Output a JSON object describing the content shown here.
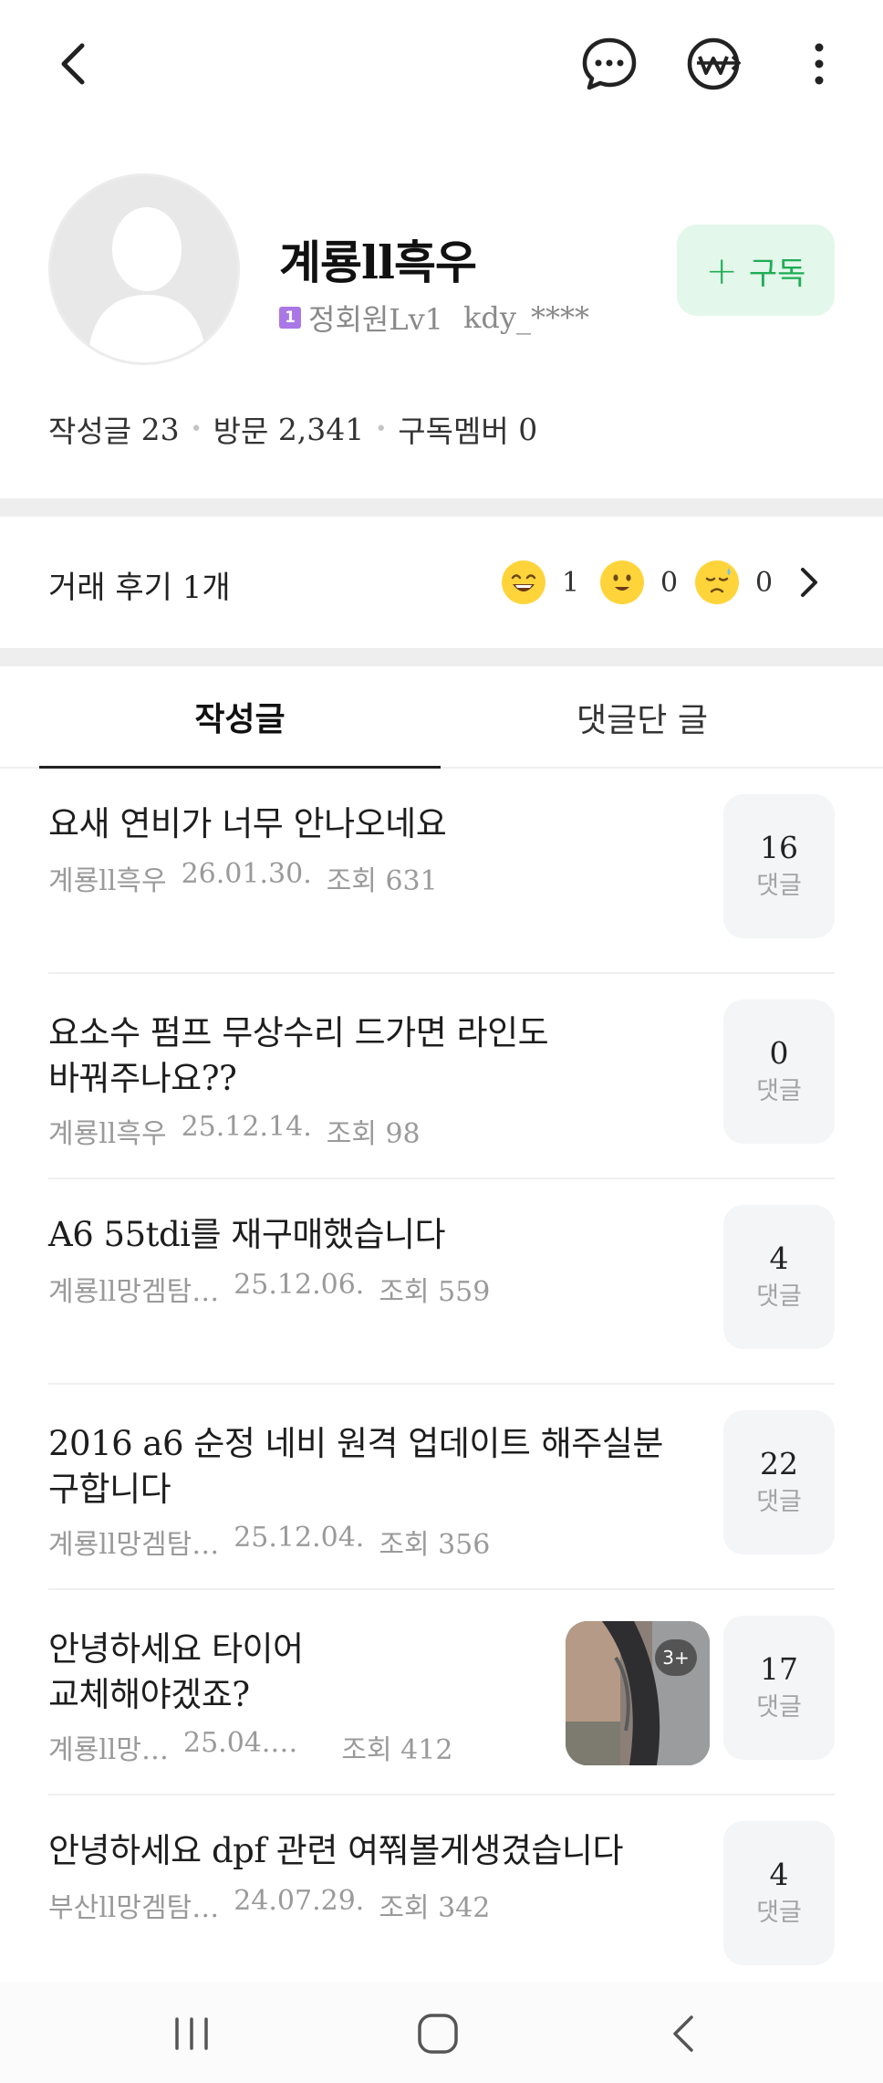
{
  "profile": {
    "nickname": "계룡ll흑우",
    "level_badge": "1",
    "level_name": "정회원Lv1",
    "user_id": "kdy_****",
    "subscribe_plus": "+",
    "subscribe_label": "구독",
    "stats": {
      "posts_label": "작성글",
      "posts_value": "23",
      "visits_label": "방문",
      "visits_value": "2,341",
      "subscribers_label": "구독멤버",
      "subscribers_value": "0"
    }
  },
  "reviews": {
    "label": "거래 후기 1개",
    "items": [
      {
        "icon": "laughing-face-icon",
        "count": "1"
      },
      {
        "icon": "smiling-face-icon",
        "count": "0"
      },
      {
        "icon": "sad-face-icon",
        "count": "0"
      }
    ]
  },
  "tabs": [
    {
      "label": "작성글",
      "selected": true
    },
    {
      "label": "댓글단 글",
      "selected": false
    }
  ],
  "posts": [
    {
      "title_lines": [
        "요새 연비가 너무 안나오네요"
      ],
      "author": "계룡ll흑우",
      "date": "26.01.30.",
      "views": "조회 631",
      "comments": "16",
      "comments_label": "댓글"
    },
    {
      "title_lines": [
        "요소수 펌프 무상수리 드가면 라인도",
        "바꿔주나요??"
      ],
      "author": "계룡ll흑우",
      "date": "25.12.14.",
      "views": "조회 98",
      "comments": "0",
      "comments_label": "댓글"
    },
    {
      "title_lines": [
        "A6 55tdi를 재구매했습니다"
      ],
      "author": "계룡ll망겜탐…",
      "date": "25.12.06.",
      "views": "조회 559",
      "comments": "4",
      "comments_label": "댓글"
    },
    {
      "title_lines": [
        "2016 a6 순정 네비 원격 업데이트 해주실분",
        "구합니다"
      ],
      "author": "계룡ll망겜탐…",
      "date": "25.12.04.",
      "views": "조회 356",
      "comments": "22",
      "comments_label": "댓글"
    },
    {
      "title_lines": [
        "안녕하세요 타이어",
        "교체해야겠죠?"
      ],
      "author": "계룡ll망…",
      "date": "25.04.…",
      "views": "조회 412",
      "comments": "17",
      "comments_label": "댓글",
      "thumbnail_badge": "3+"
    },
    {
      "title_lines": [
        "안녕하세요 dpf 관련 여쭤볼게생겼습니다"
      ],
      "author": "부산ll망겜탐…",
      "date": "24.07.29.",
      "views": "조회 342",
      "comments": "4",
      "comments_label": "댓글"
    }
  ],
  "colors": {
    "accent_green": "#1fad56",
    "subscribe_bg": "#e3f7ea",
    "level_badge": "#a978e6",
    "emoji_yellow": "#ffd43b"
  }
}
